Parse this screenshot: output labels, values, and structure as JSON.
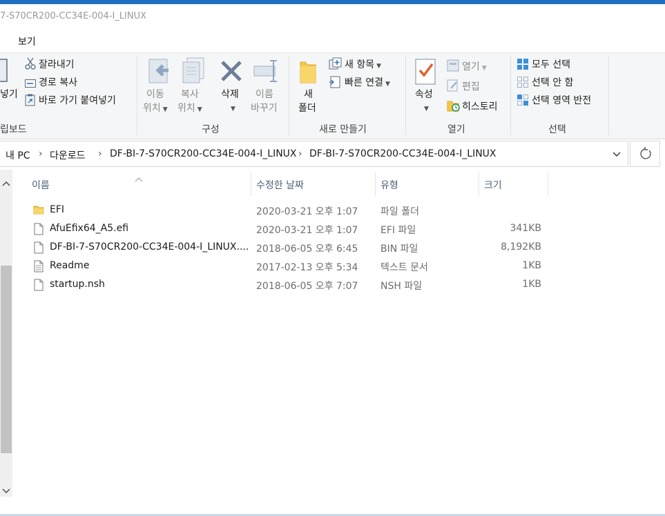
{
  "window": {
    "title": "7-S70CR200-CC34E-004-I_LINUX"
  },
  "menu": {
    "view_tab": "보기"
  },
  "ribbon": {
    "clipboard": {
      "label": "립보드",
      "paste_partial": "넣기",
      "cut": "잘라내기",
      "copy_path": "경로 복사",
      "paste_shortcut": "바로 가기 붙여넣기"
    },
    "organize": {
      "label": "구성",
      "move_to_1": "이동",
      "move_to_2": "위치",
      "copy_to_1": "복사",
      "copy_to_2": "위치",
      "delete": "삭제",
      "rename_1": "이름",
      "rename_2": "바꾸기"
    },
    "new": {
      "label": "새로 만들기",
      "new_folder_1": "새",
      "new_folder_2": "폴더",
      "new_item": "새 항목",
      "easy_access": "빠른 연결"
    },
    "open": {
      "label": "열기",
      "properties": "속성",
      "open": "열기",
      "edit": "편집",
      "history": "히스토리"
    },
    "select": {
      "label": "선택",
      "select_all": "모두 선택",
      "select_none": "선택 안 함",
      "invert": "선택 영역 반전"
    }
  },
  "address": {
    "crumbs": [
      "내 PC",
      "다운로드",
      "DF-BI-7-S70CR200-CC34E-004-I_LINUX",
      "DF-BI-7-S70CR200-CC34E-004-I_LINUX"
    ]
  },
  "columns": {
    "name": "이름",
    "date": "수정한 날짜",
    "type": "유형",
    "size": "크기"
  },
  "files": [
    {
      "name": "EFI",
      "date": "2020-03-21 오후 1:07",
      "type": "파일 폴더",
      "size": "",
      "icon": "folder-icon"
    },
    {
      "name": "AfuEfix64_A5.efi",
      "date": "2020-03-21 오후 1:07",
      "type": "EFI 파일",
      "size": "341KB",
      "icon": "file-icon"
    },
    {
      "name": "DF-BI-7-S70CR200-CC34E-004-I_LINUX....",
      "date": "2018-06-05 오후 6:45",
      "type": "BIN 파일",
      "size": "8,192KB",
      "icon": "file-icon"
    },
    {
      "name": "Readme",
      "date": "2017-02-13 오후 5:34",
      "type": "텍스트 문서",
      "size": "1KB",
      "icon": "text-file-icon"
    },
    {
      "name": "startup.nsh",
      "date": "2018-06-05 오후 7:07",
      "type": "NSH 파일",
      "size": "1KB",
      "icon": "file-icon"
    }
  ],
  "colors": {
    "accent": "#1f6fbf",
    "header_text": "#4c607a"
  }
}
